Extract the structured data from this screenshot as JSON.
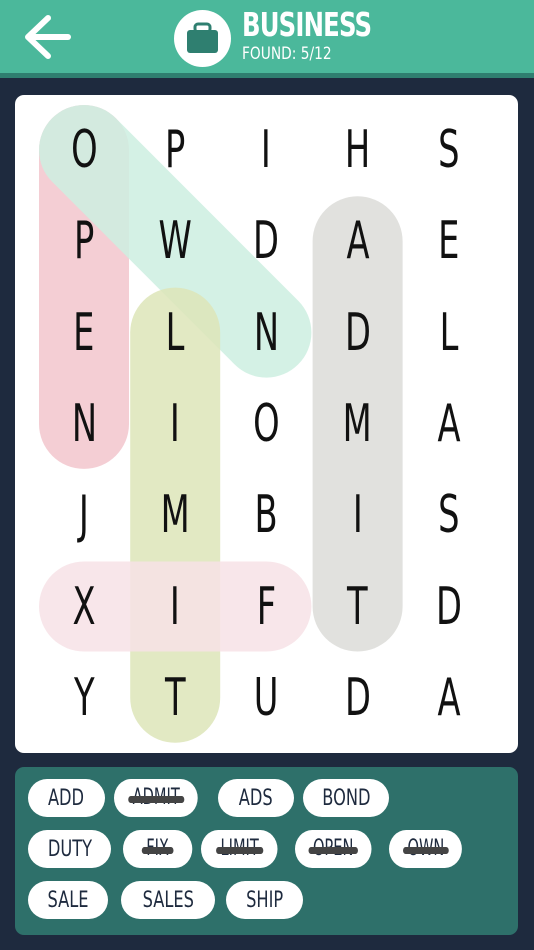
{
  "header": {
    "title": "BUSINESS",
    "found_label": "FOUND:",
    "found_count": "5/12",
    "back_icon": "arrow-left-icon",
    "category_icon": "briefcase-icon",
    "color": "#4bb89b"
  },
  "grid": [
    [
      "O",
      "P",
      "I",
      "H",
      "S"
    ],
    [
      "P",
      "W",
      "D",
      "A",
      "E"
    ],
    [
      "E",
      "L",
      "N",
      "D",
      "L"
    ],
    [
      "N",
      "I",
      "O",
      "M",
      "A"
    ],
    [
      "J",
      "M",
      "B",
      "I",
      "S"
    ],
    [
      "X",
      "I",
      "F",
      "T",
      "D"
    ],
    [
      "Y",
      "T",
      "U",
      "D",
      "A"
    ]
  ],
  "found_paths": [
    {
      "word": "OPEN",
      "from": [
        0,
        0
      ],
      "to": [
        3,
        0
      ],
      "color": "#f2c6cc"
    },
    {
      "word": "OWN",
      "from": [
        0,
        0
      ],
      "to": [
        2,
        2
      ],
      "color": "#cdeee0"
    },
    {
      "word": "LIMIT",
      "from": [
        2,
        1
      ],
      "to": [
        6,
        1
      ],
      "color": "#dde5b9"
    },
    {
      "word": "ADMIT",
      "from": [
        1,
        3
      ],
      "to": [
        5,
        3
      ],
      "color": "#dcdcd8"
    },
    {
      "word": "FIX",
      "from": [
        5,
        0
      ],
      "to": [
        5,
        2
      ],
      "color": "#f7e2e6"
    }
  ],
  "words": [
    {
      "label": "ADD",
      "found": false
    },
    {
      "label": "ADMIT",
      "found": true
    },
    {
      "label": "ADS",
      "found": false
    },
    {
      "label": "BOND",
      "found": false
    },
    {
      "label": "DUTY",
      "found": false
    },
    {
      "label": "FIX",
      "found": true
    },
    {
      "label": "LIMIT",
      "found": true
    },
    {
      "label": "OPEN",
      "found": true
    },
    {
      "label": "OWN",
      "found": true
    },
    {
      "label": "SALE",
      "found": false
    },
    {
      "label": "SALES",
      "found": false
    },
    {
      "label": "SHIP",
      "found": false
    }
  ]
}
